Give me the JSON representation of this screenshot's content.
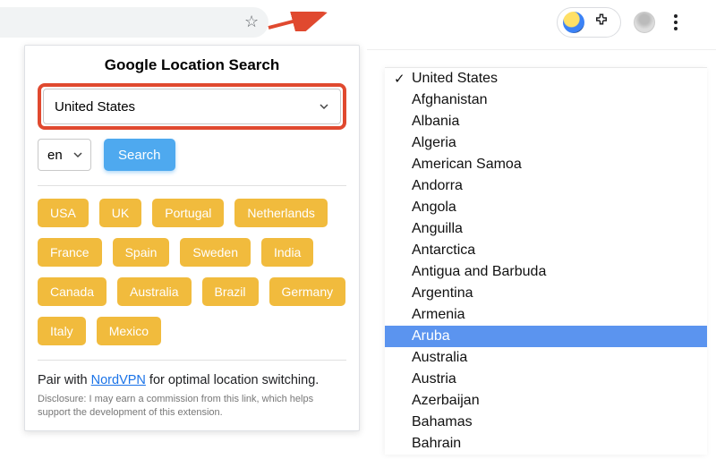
{
  "toolbar": {
    "star_icon": "star-icon",
    "extension_icon": "location-search-extension-icon",
    "extensions_puzzle": "extensions-icon",
    "avatar": "profile-avatar",
    "menu": "browser-menu"
  },
  "panel": {
    "title": "Google Location Search",
    "country_selected": "United States",
    "lang_selected": "en",
    "search_label": "Search",
    "chips": [
      "USA",
      "UK",
      "Portugal",
      "Netherlands",
      "France",
      "Spain",
      "Sweden",
      "India",
      "Canada",
      "Australia",
      "Brazil",
      "Germany",
      "Italy",
      "Mexico"
    ],
    "pair_prefix": "Pair with ",
    "pair_link": "NordVPN",
    "pair_suffix": " for optimal location switching.",
    "disclosure": "Disclosure: I may earn a commission from this link, which helps support the development of this extension."
  },
  "dropdown": {
    "selected": "United States",
    "highlighted": "Aruba",
    "options": [
      "United States",
      "Afghanistan",
      "Albania",
      "Algeria",
      "American Samoa",
      "Andorra",
      "Angola",
      "Anguilla",
      "Antarctica",
      "Antigua and Barbuda",
      "Argentina",
      "Armenia",
      "Aruba",
      "Australia",
      "Austria",
      "Azerbaijan",
      "Bahamas",
      "Bahrain"
    ]
  }
}
